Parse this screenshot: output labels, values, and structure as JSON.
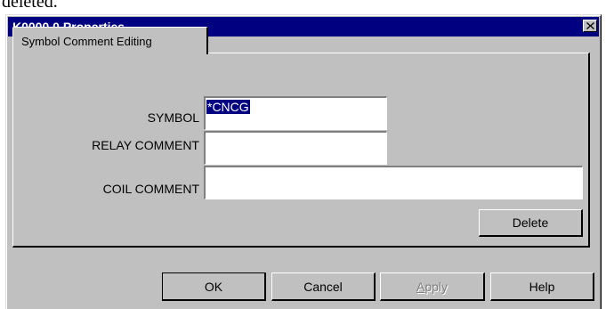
{
  "background": {
    "top_text": "deleted."
  },
  "window": {
    "title": "K0000.0 Properties",
    "close_glyph": "✕"
  },
  "tabs": [
    {
      "label": "Symbol Comment Editing",
      "active": true
    }
  ],
  "form": {
    "symbol": {
      "label": "SYMBOL",
      "value": "*CNCG"
    },
    "relay_comment": {
      "label": "RELAY COMMENT",
      "value": ""
    },
    "coil_comment": {
      "label": "COIL COMMENT",
      "value": ""
    },
    "delete_label": "Delete"
  },
  "buttons": {
    "ok": "OK",
    "cancel": "Cancel",
    "apply_first": "A",
    "apply_rest": "pply",
    "help": "Help"
  },
  "colors": {
    "titlebar": "#000080",
    "face": "#c0c0c0",
    "selection": "#000080"
  }
}
